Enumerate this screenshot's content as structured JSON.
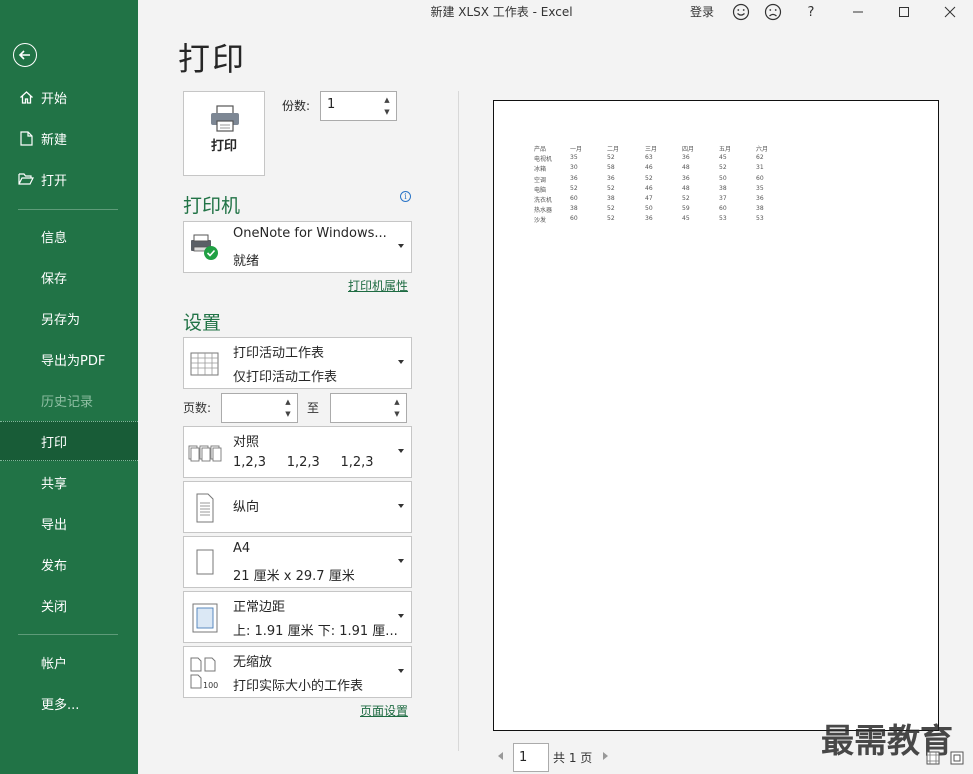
{
  "window": {
    "title": "新建 XLSX 工作表  -  Excel",
    "signin": "登录"
  },
  "sidebar": {
    "top_items": [
      {
        "label": "开始",
        "icon": "home-icon"
      },
      {
        "label": "新建",
        "icon": "new-document-icon"
      },
      {
        "label": "打开",
        "icon": "open-folder-icon"
      }
    ],
    "middle_items": [
      {
        "label": "信息"
      },
      {
        "label": "保存"
      },
      {
        "label": "另存为"
      },
      {
        "label": "导出为PDF"
      },
      {
        "label": "历史记录",
        "disabled": true
      },
      {
        "label": "打印",
        "active": true
      },
      {
        "label": "共享"
      },
      {
        "label": "导出"
      },
      {
        "label": "发布"
      },
      {
        "label": "关闭"
      }
    ],
    "bottom_items": [
      {
        "label": "帐户"
      },
      {
        "label": "更多..."
      }
    ]
  },
  "page": {
    "title": "打印"
  },
  "print": {
    "button_label": "打印",
    "copies_label": "份数:",
    "copies_value": "1"
  },
  "printer": {
    "heading": "打印机",
    "name": "OneNote for Windows...",
    "status": "就绪",
    "properties_link": "打印机属性"
  },
  "settings": {
    "heading": "设置",
    "scope": {
      "line1": "打印活动工作表",
      "line2": "仅打印活动工作表"
    },
    "pages_label": "页数:",
    "pages_to": "至",
    "collate": {
      "line1": "对照",
      "line2": "1,2,3     1,2,3     1,2,3"
    },
    "orientation": {
      "line1": "纵向"
    },
    "paper": {
      "line1": "A4",
      "line2": "21 厘米 x 29.7 厘米"
    },
    "margins": {
      "line1": "正常边距",
      "line2": "上: 1.91 厘米 下: 1.91 厘..."
    },
    "scaling": {
      "line1": "无缩放",
      "line2": "打印实际大小的工作表"
    },
    "page_setup_link": "页面设置"
  },
  "preview": {
    "headers": [
      "产品",
      "一月",
      "二月",
      "三月",
      "四月",
      "五月",
      "六月"
    ],
    "rows": [
      [
        "电视机",
        "35",
        "52",
        "63",
        "36",
        "45",
        "62"
      ],
      [
        "冰箱",
        "30",
        "58",
        "46",
        "48",
        "52",
        "31"
      ],
      [
        "空调",
        "36",
        "36",
        "52",
        "36",
        "50",
        "60"
      ],
      [
        "电脑",
        "52",
        "52",
        "46",
        "48",
        "38",
        "35"
      ],
      [
        "洗衣机",
        "60",
        "38",
        "47",
        "52",
        "37",
        "36"
      ],
      [
        "热水器",
        "38",
        "52",
        "50",
        "59",
        "60",
        "38"
      ],
      [
        "沙发",
        "60",
        "52",
        "36",
        "45",
        "53",
        "53"
      ]
    ]
  },
  "pager": {
    "current_page": "1",
    "total_text": "共 1 页"
  },
  "watermark": "最需教育",
  "colors": {
    "sidebar": "#217346",
    "sidebar_active": "#185c37",
    "accent": "#217346"
  }
}
